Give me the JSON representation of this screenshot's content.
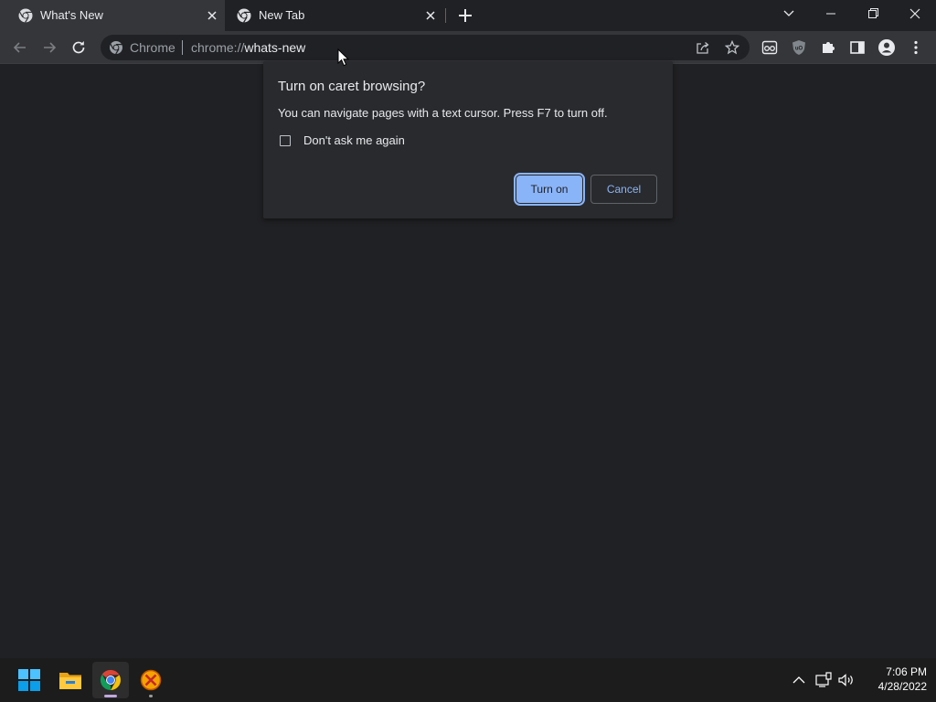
{
  "tabs": [
    {
      "title": "What's New",
      "active": true
    },
    {
      "title": "New Tab",
      "active": false
    }
  ],
  "omnibox": {
    "chip_label": "Chrome",
    "url_scheme": "chrome://",
    "url_host": "whats-new"
  },
  "dialog": {
    "title": "Turn on caret browsing?",
    "body": "You can navigate pages with a text cursor. Press F7 to turn off.",
    "checkbox_label": "Don't ask me again",
    "checkbox_checked": false,
    "primary_button": "Turn on",
    "secondary_button": "Cancel"
  },
  "taskbar": {
    "apps": [
      "start-button",
      "file-explorer",
      "google-chrome",
      "app-x"
    ],
    "time": "7:06 PM",
    "date": "4/28/2022"
  },
  "colors": {
    "accent": "#8ab4f8",
    "background": "#202124",
    "toolbar": "#35363a",
    "dialog": "#292a2d"
  }
}
